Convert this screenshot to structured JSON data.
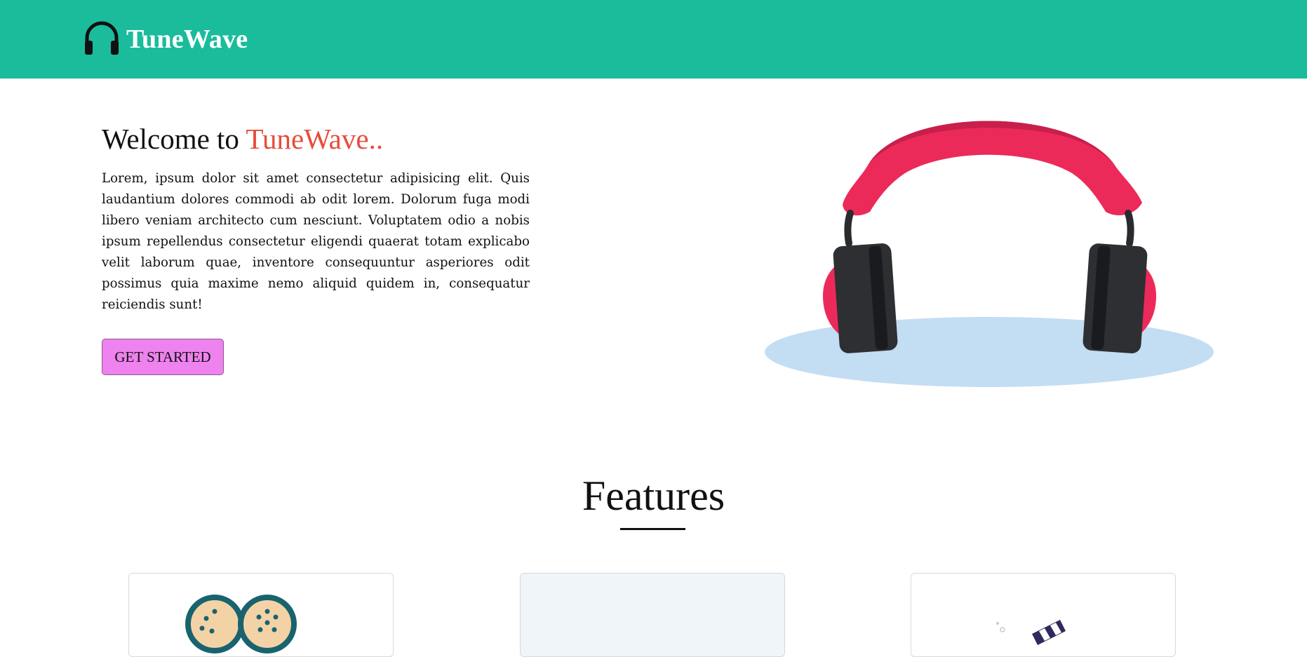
{
  "navbar": {
    "brand_name": "TuneWave",
    "brand_icon": "headphones-icon",
    "background": "#1abc9c"
  },
  "hero": {
    "title_prefix": "Welcome to ",
    "title_accent": "TuneWave..",
    "accent_color": "#e74c3c",
    "description": "Lorem, ipsum dolor sit amet consectetur adipisicing elit. Quis laudantium dolores commodi ab odit lorem. Dolorum fuga modi libero veniam architecto cum nesciunt. Voluptatem odio a nobis ipsum repellendus consectetur eligendi quaerat totam explicabo velit laborum quae, inventore consequuntur asperiores odit possimus quia maxime nemo aliquid quidem in, consequatur reiciendis sunt!",
    "cta_label": "GET STARTED",
    "cta_color": "#ee82ee",
    "illustration": "headphones-illustration"
  },
  "features": {
    "title": "Features",
    "cards": [
      {
        "icon": "film-reel-icon"
      },
      {
        "icon": ""
      },
      {
        "icon": "clapperboard-icon"
      }
    ]
  }
}
